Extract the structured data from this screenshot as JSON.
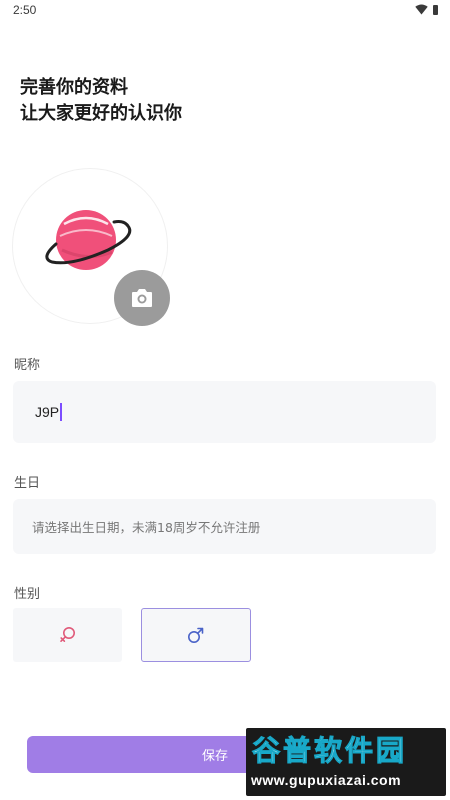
{
  "status_bar": {
    "time": "2:50"
  },
  "header": {
    "title_line1": "完善你的资料",
    "title_line2": "让大家更好的认识你"
  },
  "avatar": {
    "icon": "planet-icon",
    "camera_icon": "camera-icon"
  },
  "nickname": {
    "label": "昵称",
    "value": "J9P"
  },
  "birthday": {
    "label": "生日",
    "placeholder": "请选择出生日期，未满18周岁不允许注册"
  },
  "gender": {
    "label": "性别",
    "options": [
      {
        "id": "female",
        "icon": "female-icon",
        "selected": false
      },
      {
        "id": "male",
        "icon": "male-icon",
        "selected": true
      }
    ]
  },
  "save_button": {
    "label": "保存"
  },
  "watermark": {
    "title": "谷普软件园",
    "url": "www.gupuxiazai.com"
  },
  "colors": {
    "accent": "#a07de6",
    "selected_border": "#9b8fe0",
    "planet": "#f0507a",
    "female": "#e05a7a",
    "male": "#4a63c8",
    "input_bg": "#f6f7f9"
  }
}
